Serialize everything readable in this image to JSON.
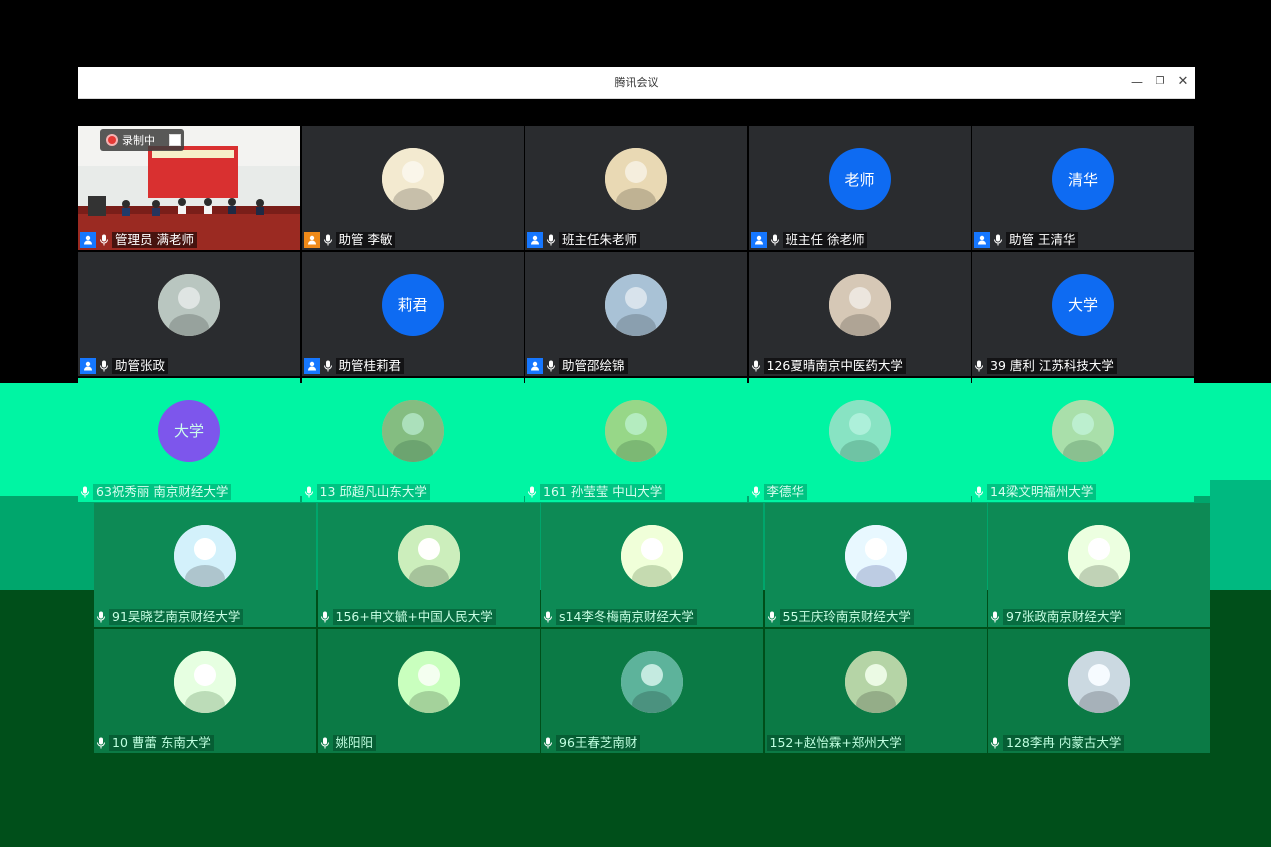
{
  "window": {
    "title": "腾讯会议",
    "controls": {
      "minimize": "—",
      "restore": "❐",
      "close": "✕"
    }
  },
  "recording": {
    "label": "录制中"
  },
  "participants": [
    {
      "name": "管理员 满老师",
      "role_icon": "host-icon",
      "badge_color": "#1677ff",
      "avatar_type": "video"
    },
    {
      "name": "助管 李敏",
      "role_icon": "cohost-icon",
      "badge_color": "#ef8a19",
      "avatar_type": "photo"
    },
    {
      "name": "班主任朱老师",
      "role_icon": "cohost-icon",
      "badge_color": "#1677ff",
      "avatar_type": "photo"
    },
    {
      "name": "班主任 徐老师",
      "role_icon": "cohost-icon",
      "badge_color": "#1677ff",
      "avatar_type": "text",
      "avatar_text": "老师"
    },
    {
      "name": "助管 王清华",
      "role_icon": "cohost-icon",
      "badge_color": "#1677ff",
      "avatar_type": "text",
      "avatar_text": "清华"
    },
    {
      "name": "助管张政",
      "role_icon": "cohost-icon",
      "badge_color": "#1677ff",
      "avatar_type": "photo"
    },
    {
      "name": "助管桂莉君",
      "role_icon": "cohost-icon",
      "badge_color": "#1677ff",
      "avatar_type": "text",
      "avatar_text": "莉君"
    },
    {
      "name": "助管邵绘锦",
      "role_icon": "cohost-icon",
      "badge_color": "#1677ff",
      "avatar_type": "photo"
    },
    {
      "name": "126夏晴南京中医药大学",
      "avatar_type": "photo"
    },
    {
      "name": "39 唐利 江苏科技大学",
      "avatar_type": "text",
      "avatar_text": "大学"
    },
    {
      "name": "63祝秀丽 南京财经大学",
      "avatar_type": "text",
      "avatar_text": "大学"
    },
    {
      "name": "13 邱超凡山东大学",
      "avatar_type": "photo"
    },
    {
      "name": "161 孙莹莹 中山大学",
      "avatar_type": "photo"
    },
    {
      "name": "李德华",
      "avatar_type": "photo"
    },
    {
      "name": "14梁文明福州大学",
      "avatar_type": "photo"
    },
    {
      "name": "91吴晓艺南京财经大学",
      "avatar_type": "photo"
    },
    {
      "name": "156+申文毓+中国人民大学",
      "avatar_type": "photo"
    },
    {
      "name": "s14李冬梅南京财经大学",
      "avatar_type": "photo"
    },
    {
      "name": "55王庆玲南京财经大学",
      "avatar_type": "photo"
    },
    {
      "name": "97张政南京财经大学",
      "avatar_type": "photo"
    },
    {
      "name": "10 曹蕾 东南大学",
      "avatar_type": "photo"
    },
    {
      "name": "姚阳阳",
      "avatar_type": "photo"
    },
    {
      "name": "96王春芝南财",
      "avatar_type": "photo"
    },
    {
      "name": "152+赵怡霖+郑州大学",
      "avatar_type": "photo",
      "no_mic": true
    },
    {
      "name": "128李冉 内蒙古大学",
      "avatar_type": "photo"
    }
  ]
}
